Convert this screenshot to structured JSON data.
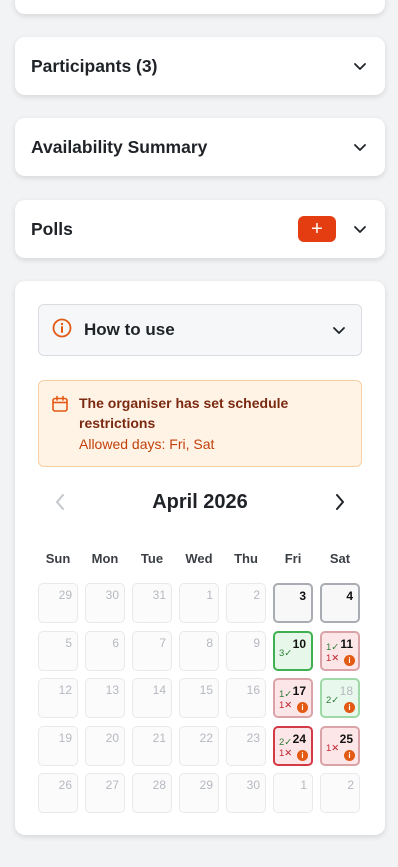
{
  "sections": {
    "participants": "Participants (3)",
    "availability": "Availability Summary",
    "polls": "Polls",
    "polls_add": "+"
  },
  "howto": {
    "title": "How to use"
  },
  "restriction": {
    "title": "The organiser has set schedule restrictions",
    "allowed": "Allowed days: Fri, Sat"
  },
  "calendar": {
    "month": "April 2026",
    "weekdays": [
      "Sun",
      "Mon",
      "Tue",
      "Wed",
      "Thu",
      "Fri",
      "Sat"
    ],
    "weeks": [
      [
        {
          "day": "29",
          "state": "disabled"
        },
        {
          "day": "30",
          "state": "disabled"
        },
        {
          "day": "31",
          "state": "disabled"
        },
        {
          "day": "1",
          "state": "disabled"
        },
        {
          "day": "2",
          "state": "disabled"
        },
        {
          "day": "3",
          "state": "active"
        },
        {
          "day": "4",
          "state": "active"
        }
      ],
      [
        {
          "day": "5",
          "state": "disabled"
        },
        {
          "day": "6",
          "state": "disabled"
        },
        {
          "day": "7",
          "state": "disabled"
        },
        {
          "day": "8",
          "state": "disabled"
        },
        {
          "day": "9",
          "state": "disabled"
        },
        {
          "day": "10",
          "state": "green",
          "yes": "3✓",
          "no": ""
        },
        {
          "day": "11",
          "state": "red",
          "yes": "1✓",
          "no": "1✕",
          "info": true
        }
      ],
      [
        {
          "day": "12",
          "state": "disabled"
        },
        {
          "day": "13",
          "state": "disabled"
        },
        {
          "day": "14",
          "state": "disabled"
        },
        {
          "day": "15",
          "state": "disabled"
        },
        {
          "day": "16",
          "state": "disabled"
        },
        {
          "day": "17",
          "state": "red",
          "yes": "1✓",
          "no": "1✕",
          "info": true
        },
        {
          "day": "18",
          "state": "greenlight",
          "yes": "2✓",
          "no": "",
          "info": true
        }
      ],
      [
        {
          "day": "19",
          "state": "disabled"
        },
        {
          "day": "20",
          "state": "disabled"
        },
        {
          "day": "21",
          "state": "disabled"
        },
        {
          "day": "22",
          "state": "disabled"
        },
        {
          "day": "23",
          "state": "disabled"
        },
        {
          "day": "24",
          "state": "redsel",
          "yes": "2✓",
          "no": "1✕",
          "info": true
        },
        {
          "day": "25",
          "state": "red",
          "yes": "",
          "no": "1✕",
          "info": true
        }
      ],
      [
        {
          "day": "26",
          "state": "disabled"
        },
        {
          "day": "27",
          "state": "disabled"
        },
        {
          "day": "28",
          "state": "disabled"
        },
        {
          "day": "29",
          "state": "disabled"
        },
        {
          "day": "30",
          "state": "disabled"
        },
        {
          "day": "1",
          "state": "disabled"
        },
        {
          "day": "2",
          "state": "disabled"
        }
      ]
    ],
    "info_glyph": "i"
  },
  "colors": {
    "accent": "#e43d12",
    "available": "#3fb04f",
    "unavailable": "#d43a46",
    "warning_bg": "#fff3e6"
  },
  "icons": {
    "chevron": "chevron-down-icon",
    "info": "info-circle-icon",
    "calendar": "calendar-icon",
    "prev": "chevron-left-icon",
    "next": "chevron-right-icon"
  }
}
